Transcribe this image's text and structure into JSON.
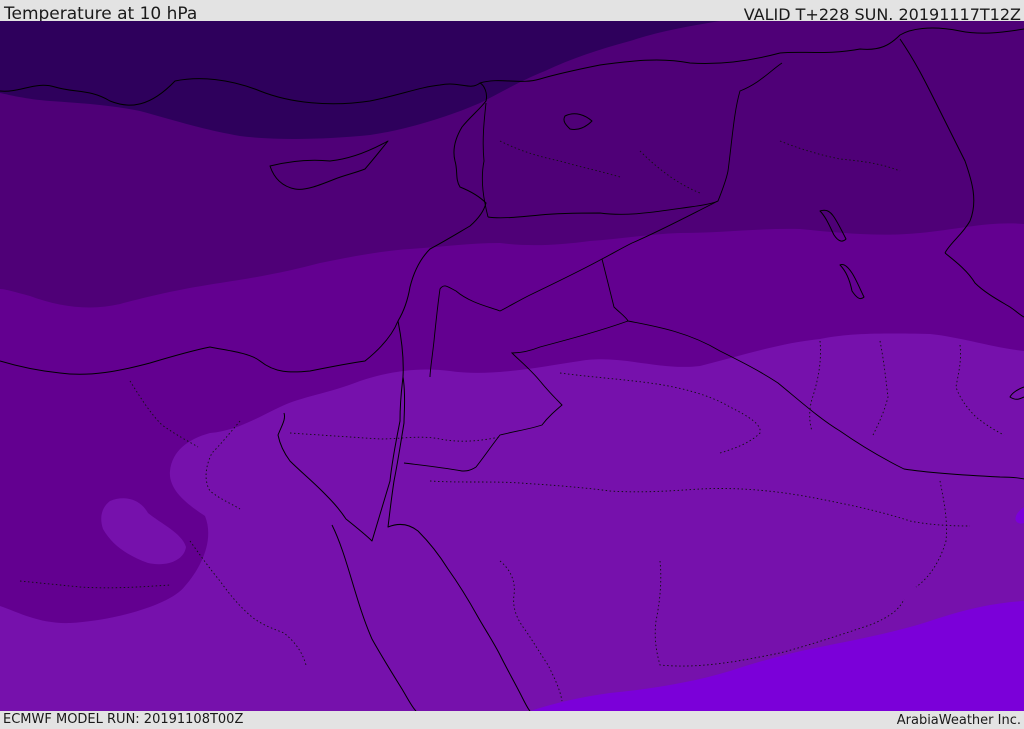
{
  "header": {
    "title": "Temperature at 10 hPa",
    "valid": "VALID T+228 SUN. 20191117T12Z"
  },
  "footer": {
    "model_run": "ECMWF MODEL RUN: 20191108T00Z",
    "credit": "ArabiaWeather Inc."
  },
  "map": {
    "field": "temperature",
    "level": "10 hPa",
    "colors": {
      "band_coldest": "#2e005c",
      "band_cold": "#4f0077",
      "band_mid": "#630090",
      "band_warm": "#7611ac",
      "band_warmest": "#7b00d9",
      "borders": "#000000"
    }
  }
}
